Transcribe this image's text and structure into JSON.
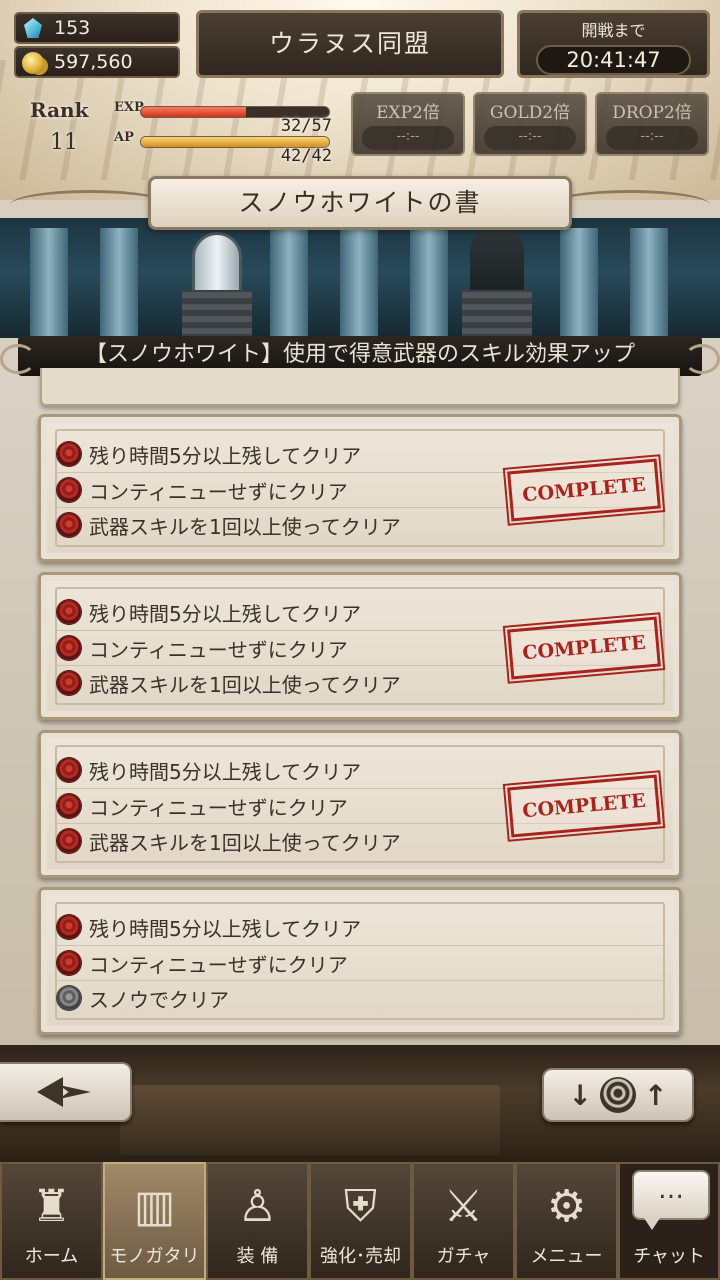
{
  "header": {
    "gems": "153",
    "gold": "597,560",
    "guild_name": "ウラヌス同盟",
    "battle_label": "開戦まで",
    "battle_countdown": "20:41:47",
    "rank_label": "Rank",
    "rank_value": "11",
    "exp_label": "EXP",
    "exp_value": "32/57",
    "exp_fraction": 0.56,
    "ap_label": "AP",
    "ap_value": "42/42",
    "ap_fraction": 1.0,
    "boosts": [
      {
        "label": "EXP2倍",
        "time": "--:--"
      },
      {
        "label": "GOLD2倍",
        "time": "--:--"
      },
      {
        "label": "DROP2倍",
        "time": "--:--"
      }
    ]
  },
  "page": {
    "title": "スノウホワイトの書",
    "subtitle": "【スノウホワイト】使用で得意武器のスキル効果アップ"
  },
  "missions": [
    {
      "items": [
        {
          "text": "残り時間5分以上残してクリア",
          "achieved": true
        },
        {
          "text": "コンティニューせずにクリア",
          "achieved": true
        },
        {
          "text": "武器スキルを1回以上使ってクリア",
          "achieved": true
        }
      ],
      "stamp": "COMPLETE"
    },
    {
      "items": [
        {
          "text": "残り時間5分以上残してクリア",
          "achieved": true
        },
        {
          "text": "コンティニューせずにクリア",
          "achieved": true
        },
        {
          "text": "武器スキルを1回以上使ってクリア",
          "achieved": true
        }
      ],
      "stamp": "COMPLETE"
    },
    {
      "items": [
        {
          "text": "残り時間5分以上残してクリア",
          "achieved": true
        },
        {
          "text": "コンティニューせずにクリア",
          "achieved": true
        },
        {
          "text": "武器スキルを1回以上使ってクリア",
          "achieved": true
        }
      ],
      "stamp": "COMPLETE"
    },
    {
      "items": [
        {
          "text": "残り時間5分以上残してクリア",
          "achieved": true
        },
        {
          "text": "コンティニューせずにクリア",
          "achieved": true
        },
        {
          "text": "スノウでクリア",
          "achieved": false
        }
      ],
      "stamp": ""
    }
  ],
  "nav": {
    "items": [
      {
        "label": "ホーム",
        "icon": "castle-icon",
        "active": false
      },
      {
        "label": "モノガタリ",
        "icon": "book-icon",
        "active": true
      },
      {
        "label": "装 備",
        "icon": "marionette-icon",
        "active": false
      },
      {
        "label": "強化･売却",
        "icon": "helmet-icon",
        "active": false
      },
      {
        "label": "ガチャ",
        "icon": "crossed-swords-icon",
        "active": false
      },
      {
        "label": "メニュー",
        "icon": "gears-icon",
        "active": false
      }
    ],
    "chat_label": "チャット",
    "chat_bubble": "…"
  },
  "colors": {
    "stamp": "#a8231d",
    "rose_active": "#b52b24",
    "rose_inactive": "#888888",
    "exp_bar": "#c8341d",
    "ap_bar": "#d18f1e"
  }
}
